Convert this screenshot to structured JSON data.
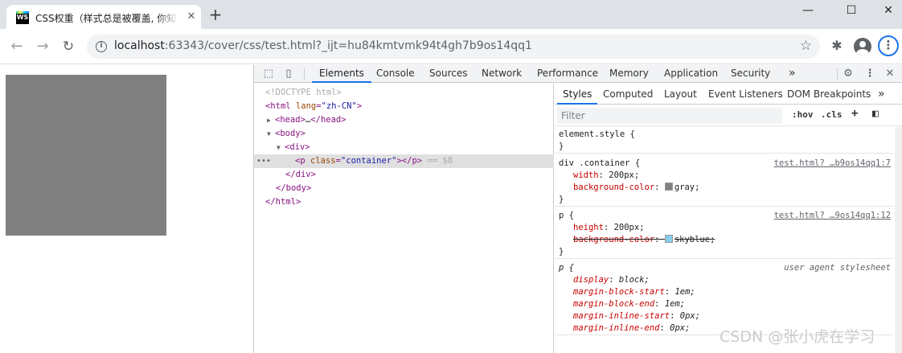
{
  "tab": {
    "favicon_text": "WS",
    "title": "CSS权重（样式总是被覆盖, 你知道吗）",
    "close": "✕"
  },
  "new_tab": "+",
  "window": {
    "minimize": "—",
    "maximize": "☐",
    "close": "✕"
  },
  "toolbar": {
    "back": "←",
    "forward": "→",
    "reload": "↻",
    "url_host": "localhost",
    "url_rest": ":63343/cover/css/test.html?_ijt=hu84kmtvmk94t4gh7b9os14qq1",
    "star": "☆",
    "extensions": "✱",
    "menu": "⋮"
  },
  "page": {
    "container_color": "#808080"
  },
  "devtools": {
    "tabs": [
      "Elements",
      "Console",
      "Sources",
      "Network",
      "Performance",
      "Memory",
      "Application",
      "Security"
    ],
    "active_tab": "Elements",
    "more": "»",
    "settings": "⚙",
    "menu": "⋮",
    "close": "✕",
    "dom": {
      "doctype": "<!DOCTYPE html>",
      "html_open_tag": "html",
      "html_attr": "lang",
      "html_attr_val": "\"zh-CN\"",
      "head_tag": "head",
      "head_collapsed": "…",
      "body_tag": "body",
      "div_tag": "div",
      "p_tag": "p",
      "p_attr": "class",
      "p_attr_val": "\"container\"",
      "selected_marker": " == $0",
      "row_dots": "•••"
    },
    "styles": {
      "subtabs": [
        "Styles",
        "Computed",
        "Layout",
        "Event Listeners",
        "DOM Breakpoints"
      ],
      "more": "»",
      "filter_placeholder": "Filter",
      "hov": ":hov",
      "cls": ".cls",
      "plus": "+",
      "element_style": "element.style {",
      "close_brace": "}",
      "rule1": {
        "selector": "div .container {",
        "source": "test.html? …b9os14qq1:7",
        "props": [
          {
            "name": "width",
            "value": "200px;"
          },
          {
            "name": "background-color",
            "value": "gray;",
            "swatch": "#808080"
          }
        ]
      },
      "rule2": {
        "selector": "p {",
        "source": "test.html? …9os14qq1:12",
        "props": [
          {
            "name": "height",
            "value": "200px;"
          },
          {
            "name": "background-color",
            "value": "skyblue;",
            "swatch": "#87ceeb"
          }
        ]
      },
      "rule3": {
        "selector": "p {",
        "source": "user agent stylesheet",
        "props": [
          {
            "name": "display",
            "value": "block;"
          },
          {
            "name": "margin-block-start",
            "value": "1em;"
          },
          {
            "name": "margin-block-end",
            "value": "1em;"
          },
          {
            "name": "margin-inline-start",
            "value": "0px;"
          },
          {
            "name": "margin-inline-end",
            "value": "0px;"
          }
        ]
      }
    }
  },
  "watermark": "CSDN @张小虎在学习"
}
